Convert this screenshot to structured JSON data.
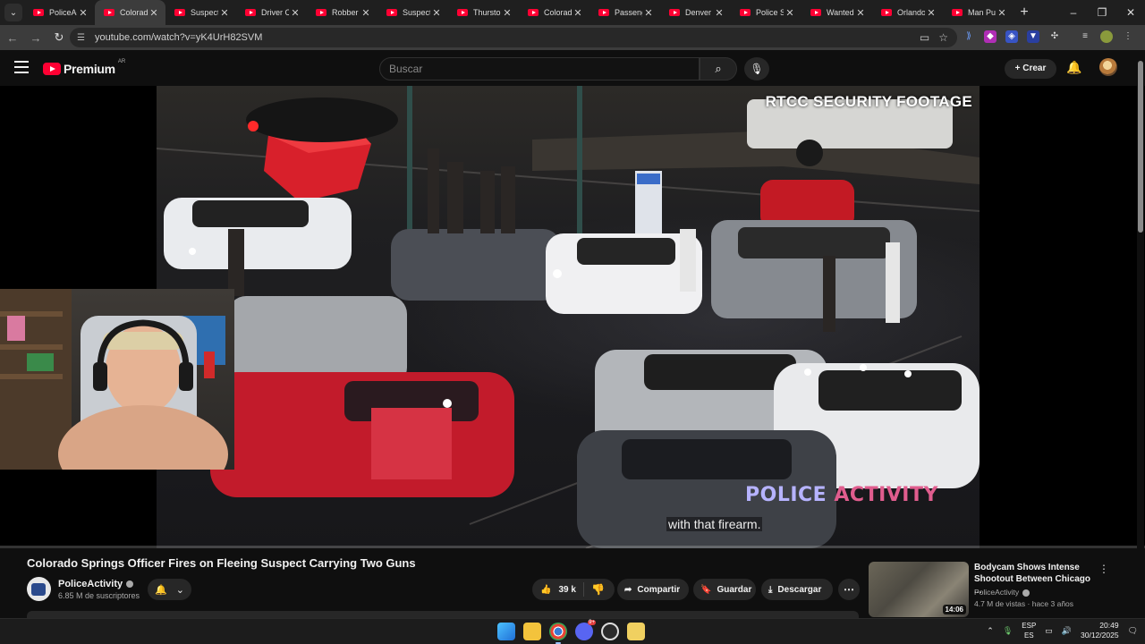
{
  "browser": {
    "tabs": [
      {
        "title": "PoliceAct",
        "active": false
      },
      {
        "title": "Colorado",
        "active": true
      },
      {
        "title": "Suspect",
        "active": false
      },
      {
        "title": "Driver Cr",
        "active": false
      },
      {
        "title": "Robber F",
        "active": false
      },
      {
        "title": "Suspect",
        "active": false
      },
      {
        "title": "Thurston",
        "active": false
      },
      {
        "title": "Colorado",
        "active": false
      },
      {
        "title": "Passenge",
        "active": false
      },
      {
        "title": "Denver F",
        "active": false
      },
      {
        "title": "Police Sh",
        "active": false
      },
      {
        "title": "Wanted",
        "active": false
      },
      {
        "title": "Orlando",
        "active": false
      },
      {
        "title": "Man Pull",
        "active": false
      }
    ],
    "url": "youtube.com/watch?v=yK4UrH82SVM"
  },
  "masthead": {
    "brand": "Premium",
    "region": "AR",
    "search_placeholder": "Buscar",
    "create_label": "Crear"
  },
  "video": {
    "overlay_label": "RTCC SECURITY FOOTAGE",
    "watermark_a": "POLICE",
    "watermark_b": "ACTIVITY",
    "subtitle": "with that firearm.",
    "progress": 0.0
  },
  "info": {
    "title": "Colorado Springs Officer Fires on Fleeing Suspect Carrying Two Guns",
    "channel": "PoliceActivity",
    "subscribers": "6.85 M de suscriptores",
    "likes": "39 k",
    "share_label": "Compartir",
    "save_label": "Guardar",
    "download_label": "Descargar"
  },
  "recommendation": {
    "title": "Bodycam Shows Intense Shootout Between Chicago ...",
    "channel": "PoliceActivity",
    "meta": "4.7 M de vistas · hace 3 años",
    "duration": "14:06"
  },
  "taskbar": {
    "lang_line1": "ESP",
    "lang_line2": "ES",
    "time": "20:49",
    "date": "30/12/2025",
    "badge": "9+"
  },
  "colors": {
    "accent_red": "#ff0033",
    "brand_purple": "#b6b3ff",
    "brand_pink": "#e05d8e"
  }
}
